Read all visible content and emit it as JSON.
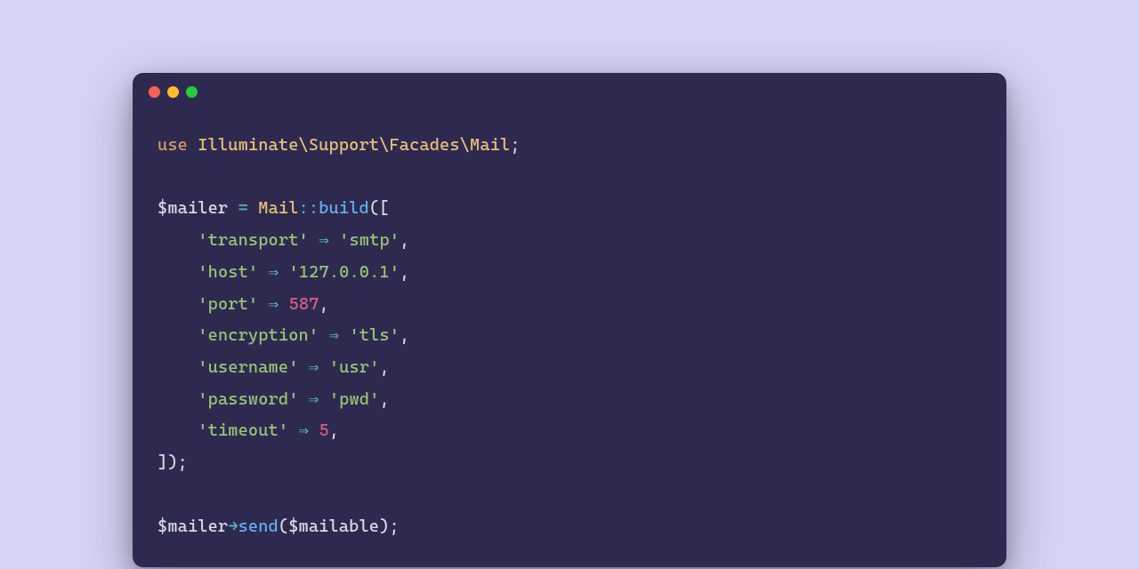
{
  "theme": {
    "background": "#d4d4f7",
    "window_bg": "#2e2a4f",
    "text": "#d7dce2",
    "keyword": "#d19a66",
    "class": "#e5c07b",
    "operator": "#56b6c2",
    "function": "#61afef",
    "string": "#98c379",
    "number": "#d75f87"
  },
  "titlebar": {
    "buttons": [
      "close",
      "minimize",
      "maximize"
    ]
  },
  "code": {
    "use_kw": "use",
    "namespace": "Illuminate\\Support\\Facades\\Mail",
    "semi": ";",
    "var_mailer": "$mailer",
    "eq": "=",
    "class_mail": "Mail",
    "dcolon": "::",
    "fn_build": "build",
    "lparen_lbracket": "([",
    "entries": [
      {
        "key": "'transport'",
        "arrow": "⇒",
        "val": "'smtp'",
        "comma": ","
      },
      {
        "key": "'host'",
        "arrow": "⇒",
        "val": "'127.0.0.1'",
        "comma": ","
      },
      {
        "key": "'port'",
        "arrow": "⇒",
        "val_num": "587",
        "comma": ","
      },
      {
        "key": "'encryption'",
        "arrow": "⇒",
        "val": "'tls'",
        "comma": ","
      },
      {
        "key": "'username'",
        "arrow": "⇒",
        "val": "'usr'",
        "comma": ","
      },
      {
        "key": "'password'",
        "arrow": "⇒",
        "val": "'pwd'",
        "comma": ","
      },
      {
        "key": "'timeout'",
        "arrow": "⇒",
        "val_num": "5",
        "comma": ","
      }
    ],
    "rbracket_rparen_semi": "]);",
    "arrow_method": "→",
    "fn_send": "send",
    "var_mailable": "$mailable",
    "lparen": "(",
    "rparen_semi": ");",
    "indent": "    "
  }
}
